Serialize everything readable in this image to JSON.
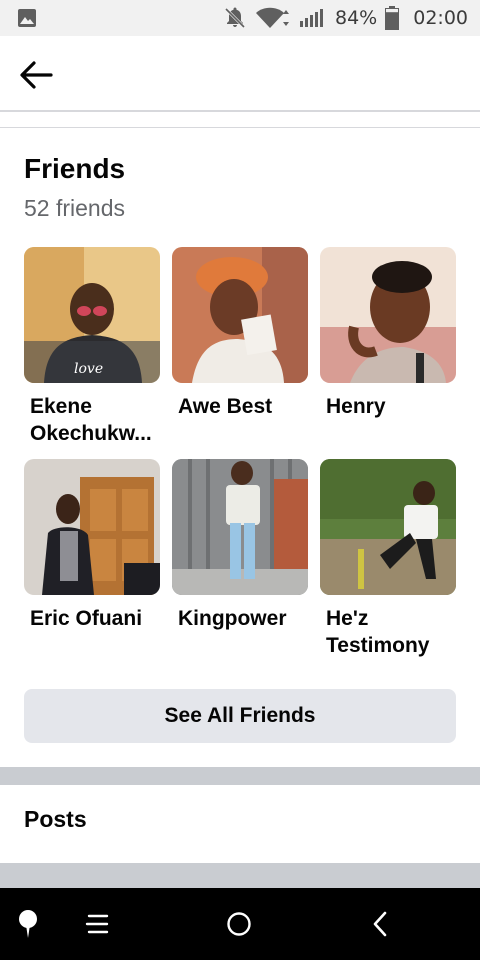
{
  "status_bar": {
    "battery_percent": "84%",
    "time": "02:00",
    "battery_level": 0.84
  },
  "friends": {
    "title": "Friends",
    "count_text": "52 friends",
    "items": [
      {
        "line1": "Ekene",
        "line2": "Okechukw..."
      },
      {
        "line1": "Awe Best",
        "line2": ""
      },
      {
        "line1": "Henry",
        "line2": ""
      },
      {
        "line1": "Eric Ofuani",
        "line2": ""
      },
      {
        "line1": "Kingpower",
        "line2": ""
      },
      {
        "line1": "He'z",
        "line2": "Testimony"
      }
    ],
    "see_all_label": "See All Friends"
  },
  "posts": {
    "title": "Posts"
  },
  "colors": {
    "button_bg": "#e4e6eb",
    "divider": "#c9ccd1",
    "secondary_text": "#65676b"
  },
  "icons": {
    "back": "arrow-left-icon",
    "gallery": "image-icon",
    "dnd": "do-not-disturb-icon",
    "wifi": "wifi-icon",
    "signal": "signal-icon",
    "battery": "battery-icon",
    "nav_assist": "pin-icon",
    "nav_menu": "menu-icon",
    "nav_home": "home-circle-icon",
    "nav_back": "chevron-left-icon"
  }
}
